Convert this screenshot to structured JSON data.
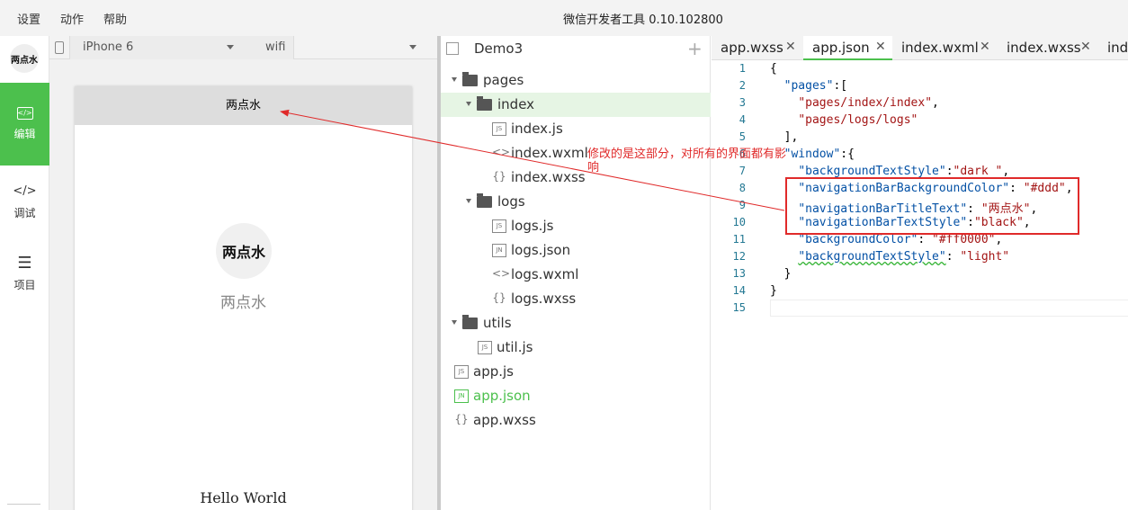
{
  "menu": {
    "items": [
      "设置",
      "动作",
      "帮助"
    ],
    "title": "微信开发者工具 0.10.102800"
  },
  "sidebar": {
    "logo": "两点水",
    "items": [
      {
        "label": "编辑",
        "icon": "code-icon"
      },
      {
        "label": "调试",
        "icon": "debug-icon"
      },
      {
        "label": "项目",
        "icon": "menu-icon"
      }
    ]
  },
  "simulator": {
    "device": "iPhone 6",
    "network": "wifi",
    "nav_title": "两点水",
    "avatar_text": "两点水",
    "nickname": "两点水",
    "hello": "Hello World"
  },
  "tree": {
    "project": "Demo3",
    "items": [
      {
        "label": "pages",
        "type": "folder"
      },
      {
        "label": "index",
        "type": "folder"
      },
      {
        "label": "index.js",
        "type": "JS"
      },
      {
        "label": "index.wxml",
        "type": "<>"
      },
      {
        "label": "index.wxss",
        "type": "{}"
      },
      {
        "label": "logs",
        "type": "folder"
      },
      {
        "label": "logs.js",
        "type": "JS"
      },
      {
        "label": "logs.json",
        "type": "JN"
      },
      {
        "label": "logs.wxml",
        "type": "<>"
      },
      {
        "label": "logs.wxss",
        "type": "{}"
      },
      {
        "label": "utils",
        "type": "folder"
      },
      {
        "label": "util.js",
        "type": "JS"
      },
      {
        "label": "app.js",
        "type": "JS"
      },
      {
        "label": "app.json",
        "type": "JN"
      },
      {
        "label": "app.wxss",
        "type": "{}"
      }
    ]
  },
  "tabs": [
    "app.wxss",
    "app.json",
    "index.wxml",
    "index.wxss",
    "ind"
  ],
  "active_tab": "app.json",
  "code_lines": [
    "{",
    "  \"pages\":[",
    "    \"pages/index/index\",",
    "    \"pages/logs/logs\"",
    "  ],",
    "  \"window\":{",
    "    \"backgroundTextStyle\":\"dark \",",
    "    \"navigationBarBackgroundColor\": \"#ddd\",",
    "    \"navigationBarTitleText\": \"两点水\",",
    "    \"navigationBarTextStyle\":\"black\",",
    "    \"backgroundColor\": \"#ff0000\",",
    "    \"backgroundTextStyle\": \"light\"",
    "  }",
    "}",
    ""
  ],
  "annotation": "修改的是这部分，对所有的界面都有影响",
  "colors": {
    "accent": "#4cc04d",
    "annotation": "#e02a2a",
    "nav_bar": "#dddddd"
  }
}
